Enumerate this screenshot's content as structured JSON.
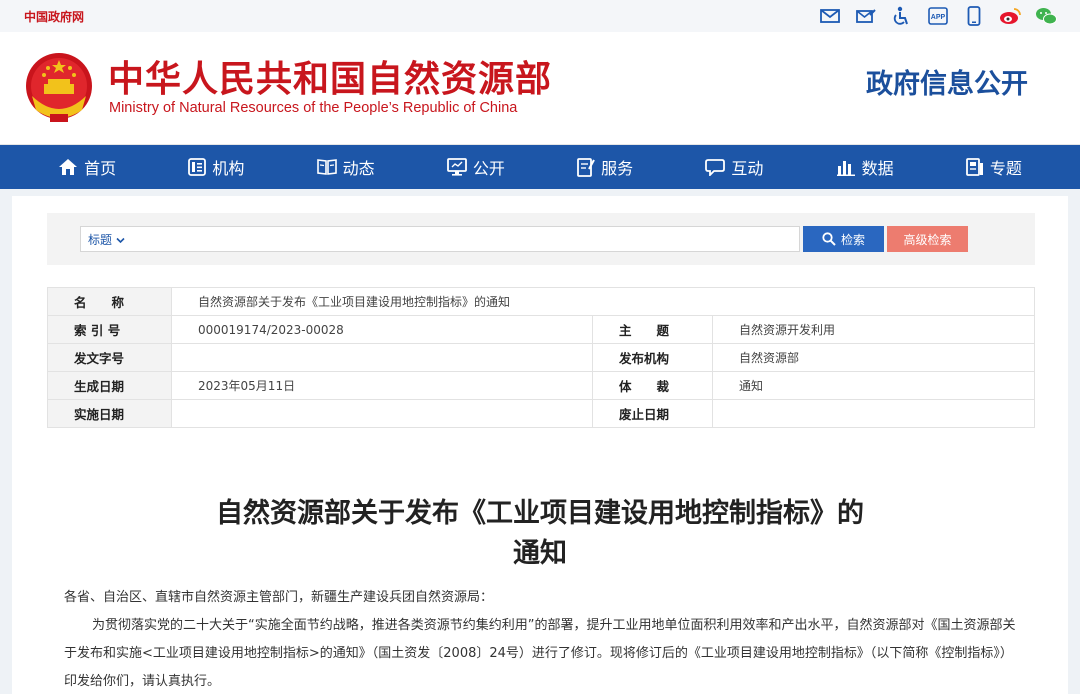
{
  "topbar": {
    "gov_link": "中国政府网",
    "icons": [
      "mail-icon",
      "envelope-edit-icon",
      "accessibility-icon",
      "app-icon",
      "mobile-icon",
      "weibo-icon",
      "wechat-icon"
    ],
    "app_label": "APP"
  },
  "header": {
    "title": "中华人民共和国自然资源部",
    "subtitle": "Ministry of Natural Resources of the People’s Republic of China",
    "section": "政府信息公开"
  },
  "nav": {
    "items": [
      {
        "label": "首页",
        "icon": "home-icon"
      },
      {
        "label": "机构",
        "icon": "organization-icon"
      },
      {
        "label": "动态",
        "icon": "book-icon"
      },
      {
        "label": "公开",
        "icon": "monitor-icon"
      },
      {
        "label": "服务",
        "icon": "document-edit-icon"
      },
      {
        "label": "互动",
        "icon": "chat-icon"
      },
      {
        "label": "数据",
        "icon": "bar-chart-icon"
      },
      {
        "label": "专题",
        "icon": "topic-icon"
      }
    ]
  },
  "search": {
    "type_label": "标题",
    "placeholder": "",
    "search_label": "检索",
    "advanced_label": "高级检索"
  },
  "info": {
    "name_label": "名　　称",
    "name_value": "自然资源部关于发布《工业项目建设用地控制指标》的通知",
    "index_label": "索 引 号",
    "index_value": "000019174/2023-00028",
    "topic_label": "主　　题",
    "topic_value": "自然资源开发利用",
    "docno_label": "发文字号",
    "docno_value": "",
    "org_label": "发布机构",
    "org_value": "自然资源部",
    "date_label": "生成日期",
    "date_value": "2023年05月11日",
    "genre_label": "体　　裁",
    "genre_value": "通知",
    "impl_label": "实施日期",
    "impl_value": "",
    "abolish_label": "废止日期",
    "abolish_value": ""
  },
  "article": {
    "title_line1": "自然资源部关于发布《工业项目建设用地控制指标》的",
    "title_line2": "通知",
    "salutation": "各省、自治区、直辖市自然资源主管部门，新疆生产建设兵团自然资源局：",
    "para1": "为贯彻落实党的二十大关于“实施全面节约战略，推进各类资源节约集约利用”的部署，提升工业用地单位面积利用效率和产出水平，自然资源部对《国土资源部关于发布和实施<工业项目建设用地控制指标>的通知》（国土资发〔2008〕24号）进行了修订。现将修订后的《工业项目建设用地控制指标》（以下简称《控制指标》）印发给你们，请认真执行。"
  },
  "colors": {
    "brand_red": "#c8161d",
    "nav_blue": "#1d56a8",
    "search_blue": "#2a67c0",
    "advanced_red": "#ed7c6f"
  }
}
